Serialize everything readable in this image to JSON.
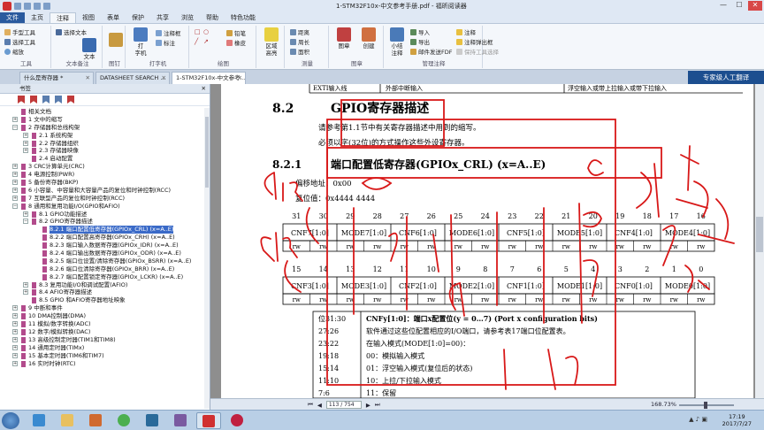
{
  "window": {
    "title": "1-STM32F10x-中文参考手册.pdf - 福昕阅读器",
    "controls": [
      "—",
      "☐",
      "✕"
    ]
  },
  "menu": [
    "文件",
    "主页",
    "注释",
    "视图",
    "表单",
    "保护",
    "共享",
    "浏览",
    "帮助",
    "特色功能"
  ],
  "ribbon": {
    "tools": {
      "items": [
        "手型工具",
        "选择工具",
        "缩放"
      ],
      "label": "工具"
    },
    "text_notes": {
      "items": [
        "选择文本"
      ],
      "big": [
        "文本"
      ],
      "label": "文本备注"
    },
    "pin": {
      "label": "图钉"
    },
    "typewriter": {
      "big": [
        "打",
        "字机"
      ],
      "items": [
        "注释框",
        "标注"
      ],
      "label": "打字机"
    },
    "drawing": {
      "items": [
        "铅笔",
        "橡皮"
      ],
      "label": "绘图"
    },
    "area": {
      "big": [
        "区域",
        "高亮"
      ]
    },
    "measure": {
      "items": [
        "距离",
        "周长",
        "面积"
      ],
      "label": "测量"
    },
    "stamp": {
      "big": [
        "图章",
        "创建"
      ],
      "label": "图章"
    },
    "summary": {
      "big": [
        "小结",
        "注释"
      ],
      "items": [
        "导入",
        "导出",
        "邮件发送FDF"
      ],
      "right_items": [
        "注释",
        "注释弹出框",
        "保持工具选择"
      ],
      "label": "管理注释"
    }
  },
  "tabs": [
    "什么是寄存器 *",
    "DATASHEET SEARCH ...",
    "1-STM32F10x-中文参考..."
  ],
  "translate_button": "专家级人工翻译",
  "sidebar": {
    "title": "书签",
    "bookmarks": [
      {
        "t": "相关文档",
        "l": 0,
        "e": ""
      },
      {
        "t": "1 文中的缩写",
        "l": 0,
        "e": "+"
      },
      {
        "t": "2 存储器和总线构架",
        "l": 0,
        "e": "−"
      },
      {
        "t": "2.1 系统构架",
        "l": 1,
        "e": "+"
      },
      {
        "t": "2.2 存储器组织",
        "l": 1,
        "e": "+"
      },
      {
        "t": "2.3 存储器映像",
        "l": 1,
        "e": "+"
      },
      {
        "t": "2.4 启动配置",
        "l": 1,
        "e": ""
      },
      {
        "t": "3 CRC计算单元(CRC)",
        "l": 0,
        "e": "+"
      },
      {
        "t": "4 电源控制(PWR)",
        "l": 0,
        "e": "+"
      },
      {
        "t": "5 备份寄存器(BKP)",
        "l": 0,
        "e": "+"
      },
      {
        "t": "6 小容量、中容量和大容量产品的复位和时钟控制(RCC)",
        "l": 0,
        "e": "+"
      },
      {
        "t": "7 互联型产品的复位和时钟控制(RCC)",
        "l": 0,
        "e": "+"
      },
      {
        "t": "8 通用和复用功能I/O(GPIO和AFIO)",
        "l": 0,
        "e": "−"
      },
      {
        "t": "8.1 GPIO功能描述",
        "l": 1,
        "e": "+"
      },
      {
        "t": "8.2 GPIO寄存器描述",
        "l": 1,
        "e": "−"
      },
      {
        "t": "8.2.1 端口配置低寄存器(GPIOx_CRL) (x=A..E)",
        "l": 2,
        "e": "",
        "sel": true
      },
      {
        "t": "8.2.2 端口配置高寄存器(GPIOx_CRH) (x=A..E)",
        "l": 2,
        "e": ""
      },
      {
        "t": "8.2.3 端口输入数据寄存器(GPIOx_IDR) (x=A..E)",
        "l": 2,
        "e": ""
      },
      {
        "t": "8.2.4 端口输出数据寄存器(GPIOx_ODR) (x=A..E)",
        "l": 2,
        "e": ""
      },
      {
        "t": "8.2.5 端口位设置/清除寄存器(GPIOx_BSRR) (x=A..E)",
        "l": 2,
        "e": ""
      },
      {
        "t": "8.2.6 端口位清除寄存器(GPIOx_BRR) (x=A..E)",
        "l": 2,
        "e": ""
      },
      {
        "t": "8.2.7 端口配置锁定寄存器(GPIOx_LCKR) (x=A..E)",
        "l": 2,
        "e": ""
      },
      {
        "t": "8.3 复用功能I/O和调试配置(AFIO)",
        "l": 1,
        "e": "+"
      },
      {
        "t": "8.4 AFIO寄存器描述",
        "l": 1,
        "e": "+"
      },
      {
        "t": "8.5 GPIO 和AFIO寄存器地址映象",
        "l": 1,
        "e": ""
      },
      {
        "t": "9 中断和事件",
        "l": 0,
        "e": "+"
      },
      {
        "t": "10 DMA控制器(DMA)",
        "l": 0,
        "e": "+"
      },
      {
        "t": "11 模拟/数字转换(ADC)",
        "l": 0,
        "e": "+"
      },
      {
        "t": "12 数字/模拟转换(DAC)",
        "l": 0,
        "e": "+"
      },
      {
        "t": "13 高级控制定时器(TIM1和TIM8)",
        "l": 0,
        "e": "+"
      },
      {
        "t": "14 通用定时器(TIMx)",
        "l": 0,
        "e": "+"
      },
      {
        "t": "15 基本定时器(TIM6和TIM7)",
        "l": 0,
        "e": "+"
      },
      {
        "t": "16 实时时钟(RTC)",
        "l": 0,
        "e": "+"
      }
    ]
  },
  "document": {
    "top_row": [
      "EXTI输入线",
      "外部中断输入",
      "浮空输入或带上拉输入或带下拉输入"
    ],
    "section": {
      "num": "8.2",
      "title": "GPIO寄存器描述"
    },
    "desc1": "请参考第1.1节中有关寄存器描述中用到的缩写。",
    "desc2": "必须以字(32位)的方式操作这些外设寄存器。",
    "subsection": {
      "num": "8.2.1",
      "title": "端口配置低寄存器(GPIOx_CRL) (x=A..E)"
    },
    "offset": "偏移地址：0x00",
    "reset": "复位值：0x4444 4444",
    "bits_hi": [
      "31",
      "30",
      "29",
      "28",
      "27",
      "26",
      "25",
      "24",
      "23",
      "22",
      "21",
      "20",
      "19",
      "18",
      "17",
      "16"
    ],
    "bits_lo": [
      "15",
      "14",
      "13",
      "12",
      "11",
      "10",
      "9",
      "8",
      "7",
      "6",
      "5",
      "4",
      "3",
      "2",
      "1",
      "0"
    ],
    "fields_hi": [
      "CNF7[1:0]",
      "MODE7[1:0]",
      "CNF6[1:0]",
      "MODE6[1:0]",
      "CNF5[1:0]",
      "MODE5[1:0]",
      "CNF4[1:0]",
      "MODE4[1:0]"
    ],
    "fields_lo": [
      "CNF3[1:0]",
      "MODE3[1:0]",
      "CNF2[1:0]",
      "MODE2[1:0]",
      "CNF1[1:0]",
      "MODE1[1:0]",
      "CNF0[1:0]",
      "MODE0[1:0]"
    ],
    "rw": "rw",
    "desc_rows": [
      {
        "bit": "位31:30",
        "text": "CNFy[1:0]：端口x配置位(y = 0…7) (Port x configuration bits)"
      },
      {
        "bit": "27:26",
        "text": "软件通过这些位配置相应的I/O端口，请参考表17端口位配置表。"
      },
      {
        "bit": "23:22",
        "text": "在输入模式(MODE[1:0]=00)："
      },
      {
        "bit": "19:18",
        "text": "00：模拟输入模式"
      },
      {
        "bit": "15:14",
        "text": "01：浮空输入模式(复位后的状态)"
      },
      {
        "bit": "11:10",
        "text": "10：上拉/下拉输入模式"
      },
      {
        "bit": "7:6",
        "text": "11：保留"
      }
    ]
  },
  "status": {
    "page": "113 / 754",
    "zoom": "168.73%"
  },
  "taskbar": {
    "time": "17:19",
    "date": "2017/7/27"
  }
}
